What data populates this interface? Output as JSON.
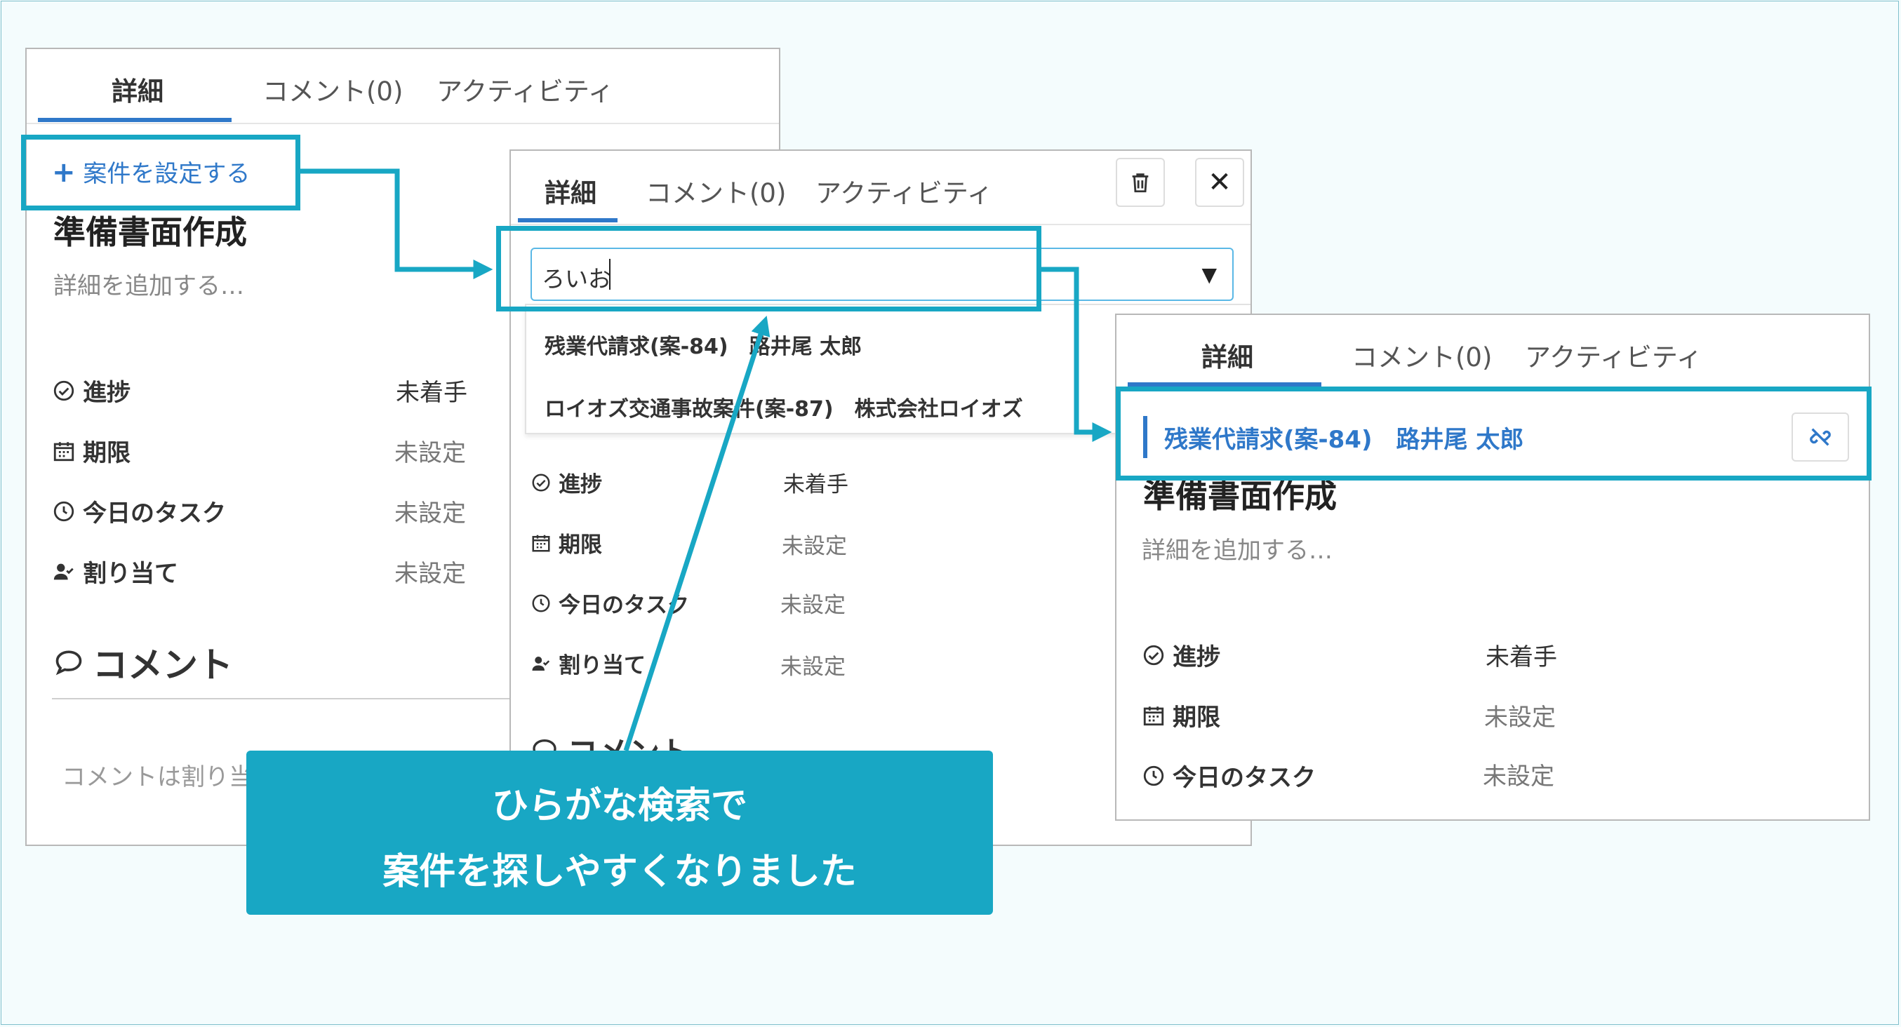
{
  "tabs": {
    "detail": "詳細",
    "comment": "コメント(0)",
    "activity": "アクティビティ"
  },
  "task": {
    "set_case_label": "案件を設定する",
    "title": "準備書面作成",
    "description_placeholder": "詳細を追加する…"
  },
  "properties": {
    "progress": {
      "label": "進捗",
      "value": "未着手"
    },
    "deadline": {
      "label": "期限",
      "value": "未設定"
    },
    "today_task": {
      "label": "今日のタスク",
      "value": "未設定"
    },
    "assignee": {
      "label": "割り当て",
      "value": "未設定"
    }
  },
  "comments": {
    "heading": "コメント",
    "placeholder": "コメントは割り当てた人にも通知されます"
  },
  "search": {
    "value": "ろいお",
    "results": [
      "残業代請求(案-84)　路井尾 太郎",
      "ロイオズ交通事故案件(案-87)　株式会社ロイオズ"
    ]
  },
  "selected_case": {
    "label": "残業代請求(案-84)　路井尾 太郎"
  },
  "callout": {
    "line1": "ひらがな検索で",
    "line2": "案件を探しやすくなりました"
  },
  "colors": {
    "highlight": "#18a7c4",
    "link": "#2f78c9",
    "background": "#f4fcfd"
  },
  "icons": {
    "add": "plus-icon",
    "delete": "trash-icon",
    "close": "close-icon",
    "dropdown": "caret-down-icon",
    "unlink": "unlink-icon",
    "progress": "check-circle-icon",
    "deadline": "calendar-icon",
    "today": "clock-icon",
    "assignee": "user-check-icon",
    "comment": "speech-bubble-icon"
  }
}
